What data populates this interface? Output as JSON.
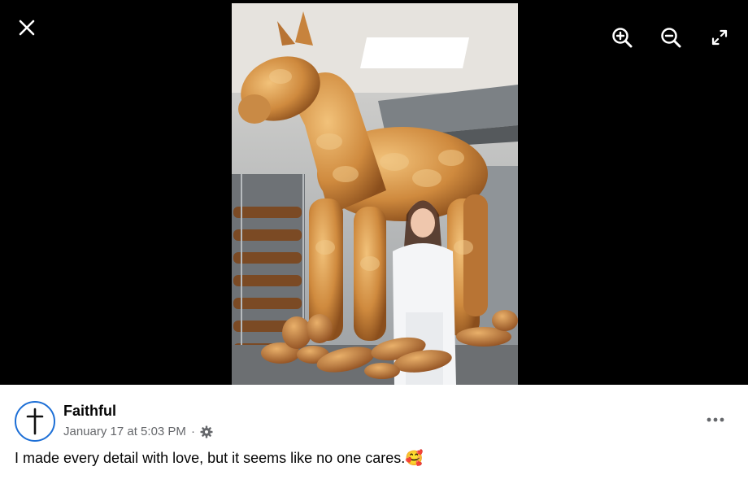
{
  "viewer": {
    "controls": {
      "close_icon": "close-icon",
      "zoom_in_icon": "zoom-in-icon",
      "zoom_out_icon": "zoom-out-icon",
      "fullscreen_icon": "fullscreen-icon"
    },
    "photo_subject": "giant braided-bread horse sculpture with baker in bakery"
  },
  "post": {
    "author": "Faithful",
    "timestamp": "January 17 at 5:03 PM",
    "separator": "·",
    "audience_icon": "gear-icon",
    "caption": "I made every detail with love, but it seems like no one cares.🥰",
    "more_icon": "more-options-icon",
    "avatar_icon": "cross-icon"
  },
  "colors": {
    "viewer_bg": "#000000",
    "avatar_ring": "#1d6fd6",
    "meta_text": "#65676b"
  }
}
